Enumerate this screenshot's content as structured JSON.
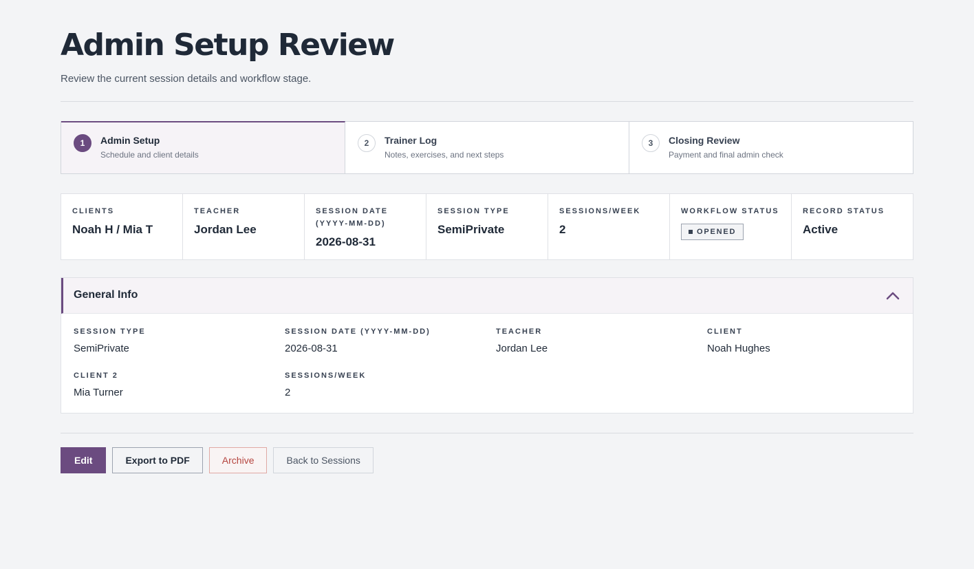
{
  "header": {
    "title": "Admin Setup Review",
    "subtitle": "Review the current session details and workflow stage."
  },
  "stepper": [
    {
      "number": "1",
      "title": "Admin Setup",
      "description": "Schedule and client details",
      "active": true
    },
    {
      "number": "2",
      "title": "Trainer Log",
      "description": "Notes, exercises, and next steps",
      "active": false
    },
    {
      "number": "3",
      "title": "Closing Review",
      "description": "Payment and final admin check",
      "active": false
    }
  ],
  "summary": {
    "clients": {
      "label": "Clients",
      "value": "Noah H / Mia T"
    },
    "teacher": {
      "label": "Teacher",
      "value": "Jordan Lee"
    },
    "session_date": {
      "label": "Session Date (YYYY-MM-DD)",
      "value": "2026-08-31"
    },
    "session_type": {
      "label": "Session Type",
      "value": "SemiPrivate"
    },
    "sessions_week": {
      "label": "Sessions/Week",
      "value": "2"
    },
    "workflow_status": {
      "label": "Workflow Status",
      "value": "OPENED"
    },
    "record_status": {
      "label": "Record Status",
      "value": "Active"
    }
  },
  "general_info": {
    "title": "General Info",
    "fields": {
      "session_type": {
        "label": "Session Type",
        "value": "SemiPrivate"
      },
      "session_date": {
        "label": "Session Date (YYYY-MM-DD)",
        "value": "2026-08-31"
      },
      "teacher": {
        "label": "Teacher",
        "value": "Jordan Lee"
      },
      "client": {
        "label": "Client",
        "value": "Noah Hughes"
      },
      "client2": {
        "label": "Client 2",
        "value": "Mia Turner"
      },
      "sessions_week": {
        "label": "Sessions/Week",
        "value": "2"
      }
    }
  },
  "actions": {
    "edit": "Edit",
    "export": "Export to PDF",
    "archive": "Archive",
    "back": "Back to Sessions"
  },
  "colors": {
    "accent": "#6b4b80",
    "danger": "#b5453f",
    "background": "#f3f4f6"
  }
}
